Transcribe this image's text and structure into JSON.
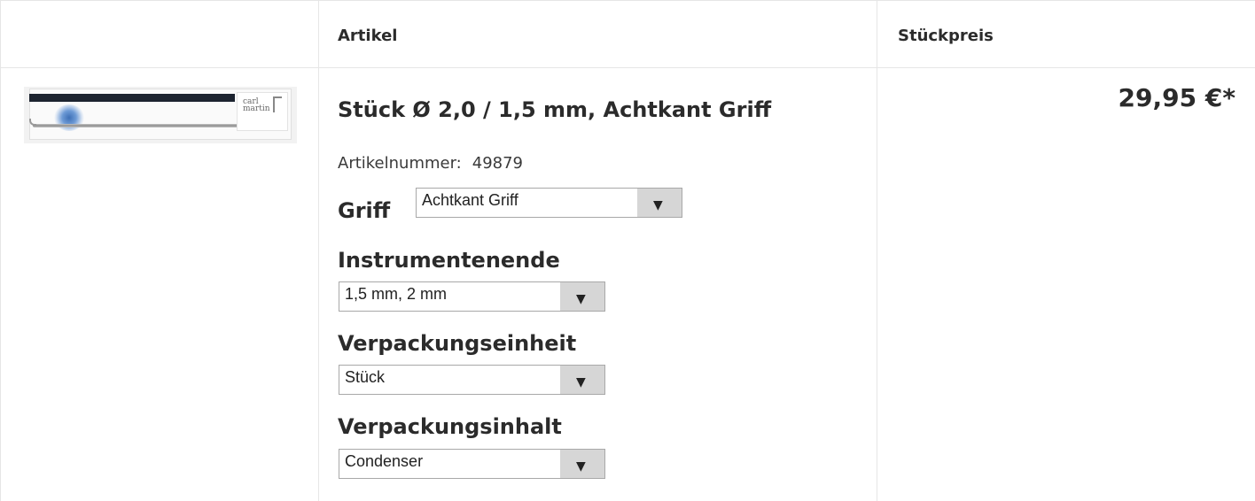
{
  "table": {
    "headers": {
      "article": "Artikel",
      "unit_price": "Stückpreis"
    }
  },
  "product": {
    "title": "Stück Ø 2,0 / 1,5 mm, Achtkant Griff",
    "article_number_label": "Artikelnummer:",
    "article_number": "49879",
    "image_brand": "carl\nmartin",
    "price": "29,95 €*"
  },
  "options": {
    "griff": {
      "label": "Griff",
      "value": "Achtkant Griff"
    },
    "instrumentenende": {
      "label": "Instrumentenende",
      "value": "1,5 mm, 2 mm"
    },
    "verpackungseinheit": {
      "label": "Verpackungseinheit",
      "value": "Stück"
    },
    "verpackungsinhalt": {
      "label": "Verpackungsinhalt",
      "value": "Condenser"
    }
  },
  "icons": {
    "dropdown": "triangle-down-icon"
  }
}
